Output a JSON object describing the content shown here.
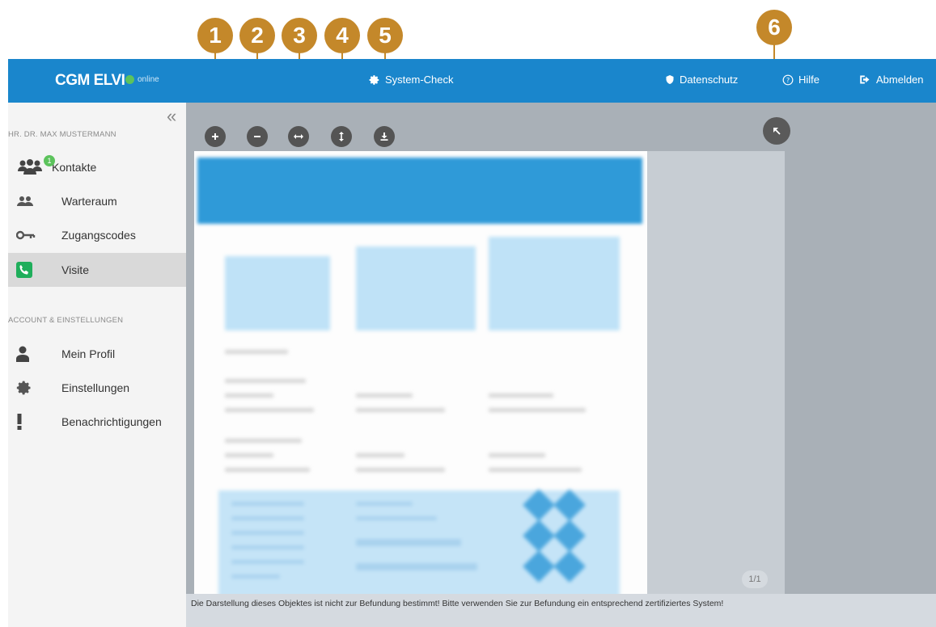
{
  "callouts": [
    "1",
    "2",
    "3",
    "4",
    "5",
    "6"
  ],
  "header": {
    "brand": "CGM ELVI",
    "status": "online",
    "system_check": "System-Check",
    "privacy": "Datenschutz",
    "help": "Hilfe",
    "logout": "Abmelden"
  },
  "sidebar": {
    "user": "HR. DR. MAX MUSTERMANN",
    "items": [
      {
        "label": "Kontakte",
        "badge": "1",
        "icon": "contacts-icon"
      },
      {
        "label": "Warteraum",
        "icon": "waiting-room-icon"
      },
      {
        "label": "Zugangscodes",
        "icon": "key-icon"
      },
      {
        "label": "Visite",
        "icon": "phone-icon",
        "active": true
      }
    ],
    "account_section": "ACCOUNT & EINSTELLUNGEN",
    "account_items": [
      {
        "label": "Mein Profil",
        "icon": "user-icon"
      },
      {
        "label": "Einstellungen",
        "icon": "gear-icon"
      },
      {
        "label": "Benachrichtigungen",
        "icon": "exclamation-icon"
      }
    ]
  },
  "viewer": {
    "tools": [
      "zoom-in-icon",
      "zoom-out-icon",
      "fit-width-icon",
      "fit-height-icon",
      "download-icon"
    ],
    "page_indicator": "1/1",
    "disclaimer": "Die Darstellung dieses Objektes ist nicht zur Befundung bestimmt! Bitte verwenden Sie zur Befundung ein entsprechend zertifiziertes System!"
  },
  "colors": {
    "header": "#1a86cc",
    "accent_callout": "#c4882a",
    "status_online": "#5cc35c",
    "call_active": "#1fae5b"
  }
}
